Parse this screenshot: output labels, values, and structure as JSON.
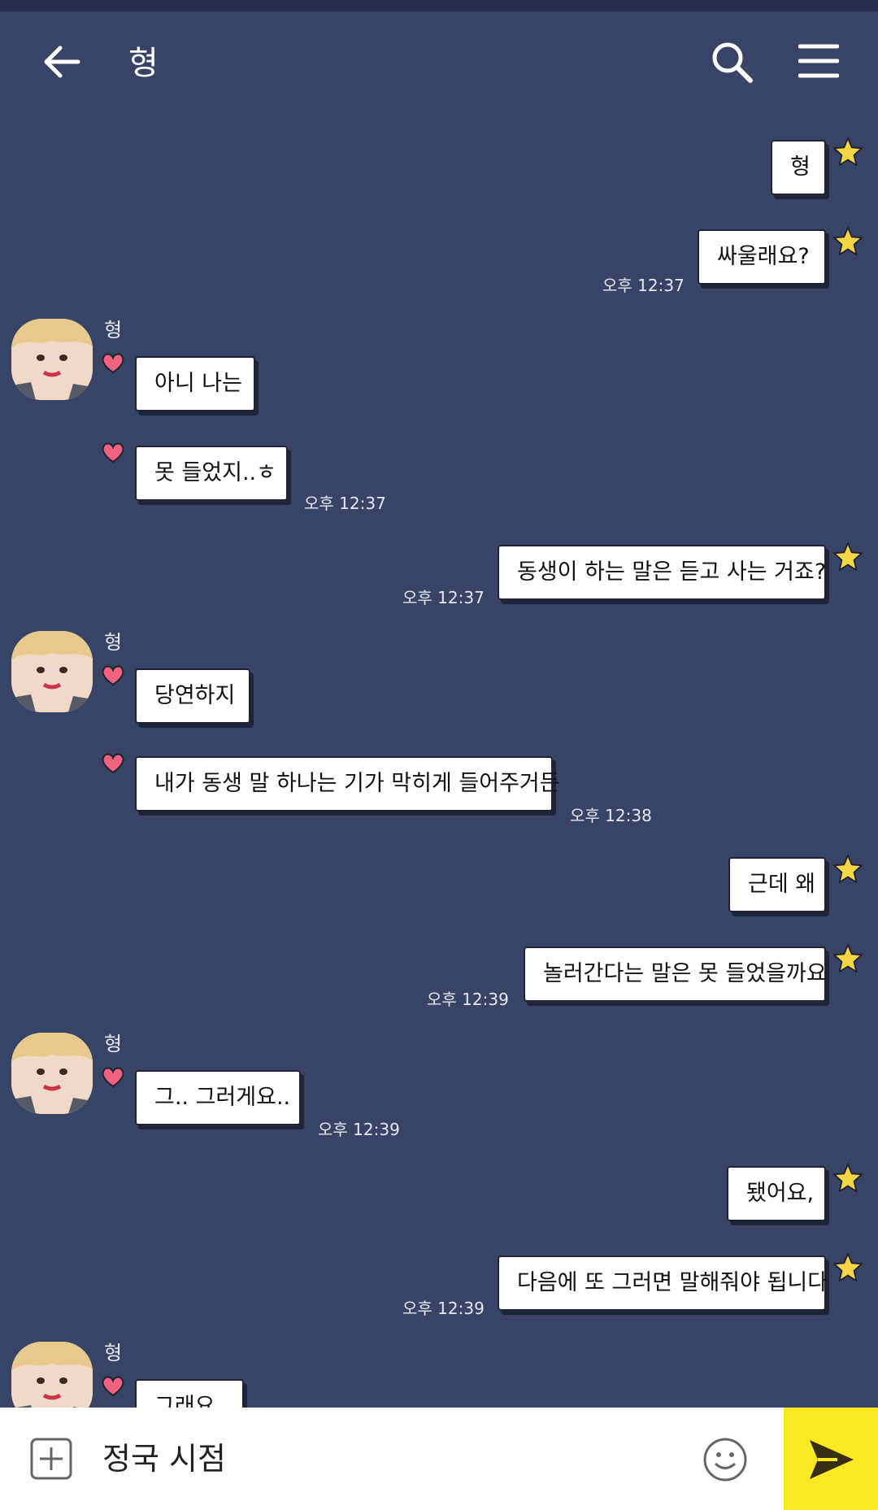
{
  "header": {
    "title": "형"
  },
  "messages": [
    {
      "dir": "out",
      "text": "형"
    },
    {
      "dir": "out",
      "text": "싸울래요?",
      "time": "오후 12:37"
    },
    {
      "dir": "in",
      "sender": "형",
      "text": "아니 나는"
    },
    {
      "dir": "in",
      "text": "못 들었지..ㅎ",
      "time": "오후 12:37"
    },
    {
      "dir": "out",
      "text": "동생이 하는 말은 듣고 사는 거죠?",
      "time": "오후 12:37"
    },
    {
      "dir": "in",
      "sender": "형",
      "text": "당연하지"
    },
    {
      "dir": "in",
      "text": "내가 동생 말 하나는 기가 막히게 들어주거든",
      "time": "오후 12:38"
    },
    {
      "dir": "out",
      "text": "근데 왜"
    },
    {
      "dir": "out",
      "text": "놀러간다는 말은 못 들었을까요",
      "time": "오후 12:39"
    },
    {
      "dir": "in",
      "sender": "형",
      "text": "그.. 그러게요.."
    },
    {
      "dir": "in",
      "time": "오후 12:39"
    },
    {
      "dir": "out",
      "text": "됐어요,"
    },
    {
      "dir": "out",
      "text": "다음에 또 그러면 말해줘야 됩니다",
      "time": "오후 12:39"
    },
    {
      "dir": "in",
      "sender": "형",
      "text": "그래요"
    }
  ],
  "input": {
    "value": "정국 시점"
  },
  "icons": {
    "back": "back-arrow-icon",
    "search": "search-icon",
    "menu": "menu-icon",
    "plus": "plus-icon",
    "emoji": "emoji-icon",
    "send": "send-icon",
    "star": "star-icon",
    "heart": "heart-icon"
  },
  "colors": {
    "background": "#374465",
    "bubble": "#ffffff",
    "send_button": "#fbe822",
    "star": "#f6d544",
    "heart": "#f0637e"
  }
}
